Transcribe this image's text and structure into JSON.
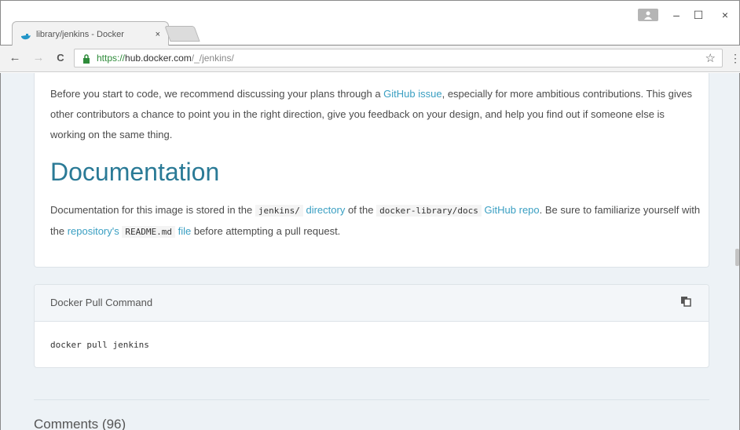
{
  "browser": {
    "tab_title": "library/jenkins - Docker",
    "tab_close": "×",
    "url_scheme": "https://",
    "url_host": "hub.docker.com",
    "url_path": "/_/jenkins/",
    "window_controls": {
      "minimize": "–",
      "maximize": "☐",
      "close": "×"
    },
    "nav": {
      "back": "←",
      "forward": "→",
      "reload": "C"
    },
    "star": "☆",
    "menu": "⋮",
    "icons": [
      "docker-whale-icon",
      "lock-icon",
      "star-icon",
      "menu-icon",
      "user-icon"
    ]
  },
  "contributing": {
    "text_1": "Before you start to code, we recommend discussing your plans through a ",
    "link_issue": "GitHub issue",
    "text_2": ", especially for more ambitious contributions. This gives other contributors a chance to point you in the right direction, give you feedback on your design, and help you find out if someone else is working on the same thing."
  },
  "documentation": {
    "heading": "Documentation",
    "t1": "Documentation for this image is stored in the ",
    "code_dir": "jenkins/",
    "link_directory": "directory",
    "t2": " of the ",
    "code_repo": "docker-library/docs",
    "link_repo": "GitHub repo",
    "t3": ". Be sure to familiarize yourself with the ",
    "link_repository": "repository's",
    "code_readme": "README.md",
    "link_file": "file",
    "t4": " before attempting a pull request."
  },
  "pull": {
    "title": "Docker Pull Command",
    "command": "docker pull jenkins"
  },
  "comments": {
    "heading": "Comments (96)"
  },
  "colors": {
    "link": "#3a9fc2",
    "heading": "#2a7a96",
    "page_bg": "#edf2f6",
    "secure_green": "#2e8b3a"
  }
}
